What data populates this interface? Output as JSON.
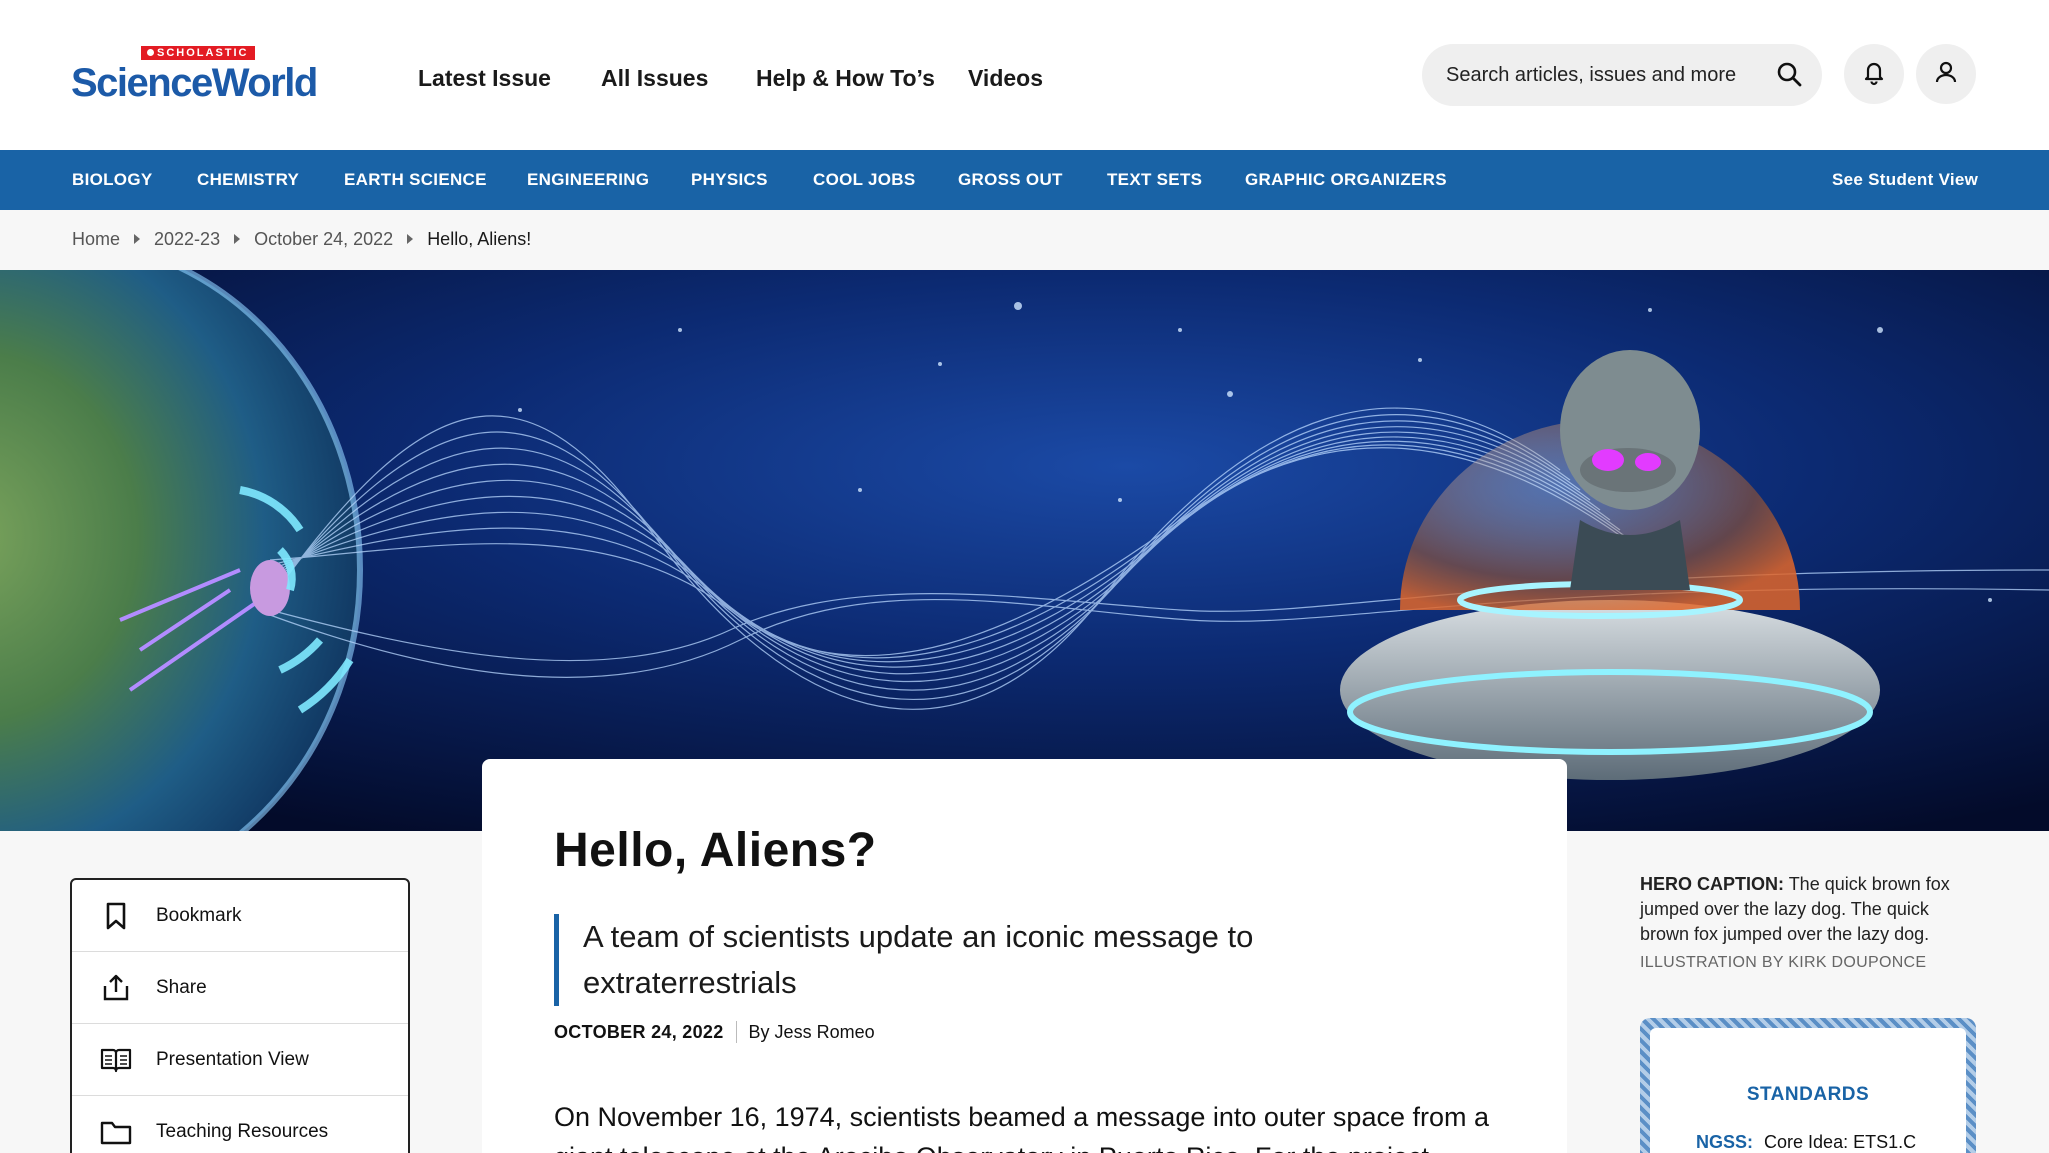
{
  "logo": {
    "brand": "SCHOLASTIC",
    "name": "ScienceWorld"
  },
  "main_nav": [
    "Latest Issue",
    "All Issues",
    "Help & How To’s",
    "Videos"
  ],
  "search": {
    "placeholder": "Search articles, issues and more"
  },
  "header_icons": [
    "bell-icon",
    "user-icon"
  ],
  "category_nav": [
    "BIOLOGY",
    "CHEMISTRY",
    "EARTH SCIENCE",
    "ENGINEERING",
    "PHYSICS",
    "COOL JOBS",
    "GROSS OUT",
    "TEXT SETS",
    "GRAPHIC ORGANIZERS"
  ],
  "student_view": "See Student View",
  "breadcrumb": [
    "Home",
    "2022-23",
    "October 24, 2022",
    "Hello, Aliens!"
  ],
  "article": {
    "title": "Hello, Aliens?",
    "dek": "A team of scientists update an iconic message to extraterrestrials",
    "date": "OCTOBER 24, 2022",
    "byline": "By Jess Romeo",
    "body": "On November 16, 1974, scientists beamed a message into outer space from a giant telescope at the Arecibo Observatory in Puerto Rico. For the project,"
  },
  "tools": [
    {
      "label": "Bookmark",
      "icon": "bookmark-icon"
    },
    {
      "label": "Share",
      "icon": "share-icon"
    },
    {
      "label": "Presentation View",
      "icon": "book-open-icon"
    },
    {
      "label": "Teaching Resources",
      "icon": "folder-icon"
    }
  ],
  "hero_caption": {
    "label": "HERO CAPTION:",
    "text": "The quick brown fox jumped over the lazy dog. The quick brown fox jumped over the lazy dog.",
    "credit": "ILLUSTRATION BY KIRK DOUPONCE"
  },
  "standards": {
    "title": "STANDARDS",
    "label": "NGSS:",
    "value": "Core Idea: ETS1.C"
  },
  "colors": {
    "brand_blue": "#1963a6",
    "logo_red": "#e31b23",
    "hero_bg": "#04123a"
  }
}
